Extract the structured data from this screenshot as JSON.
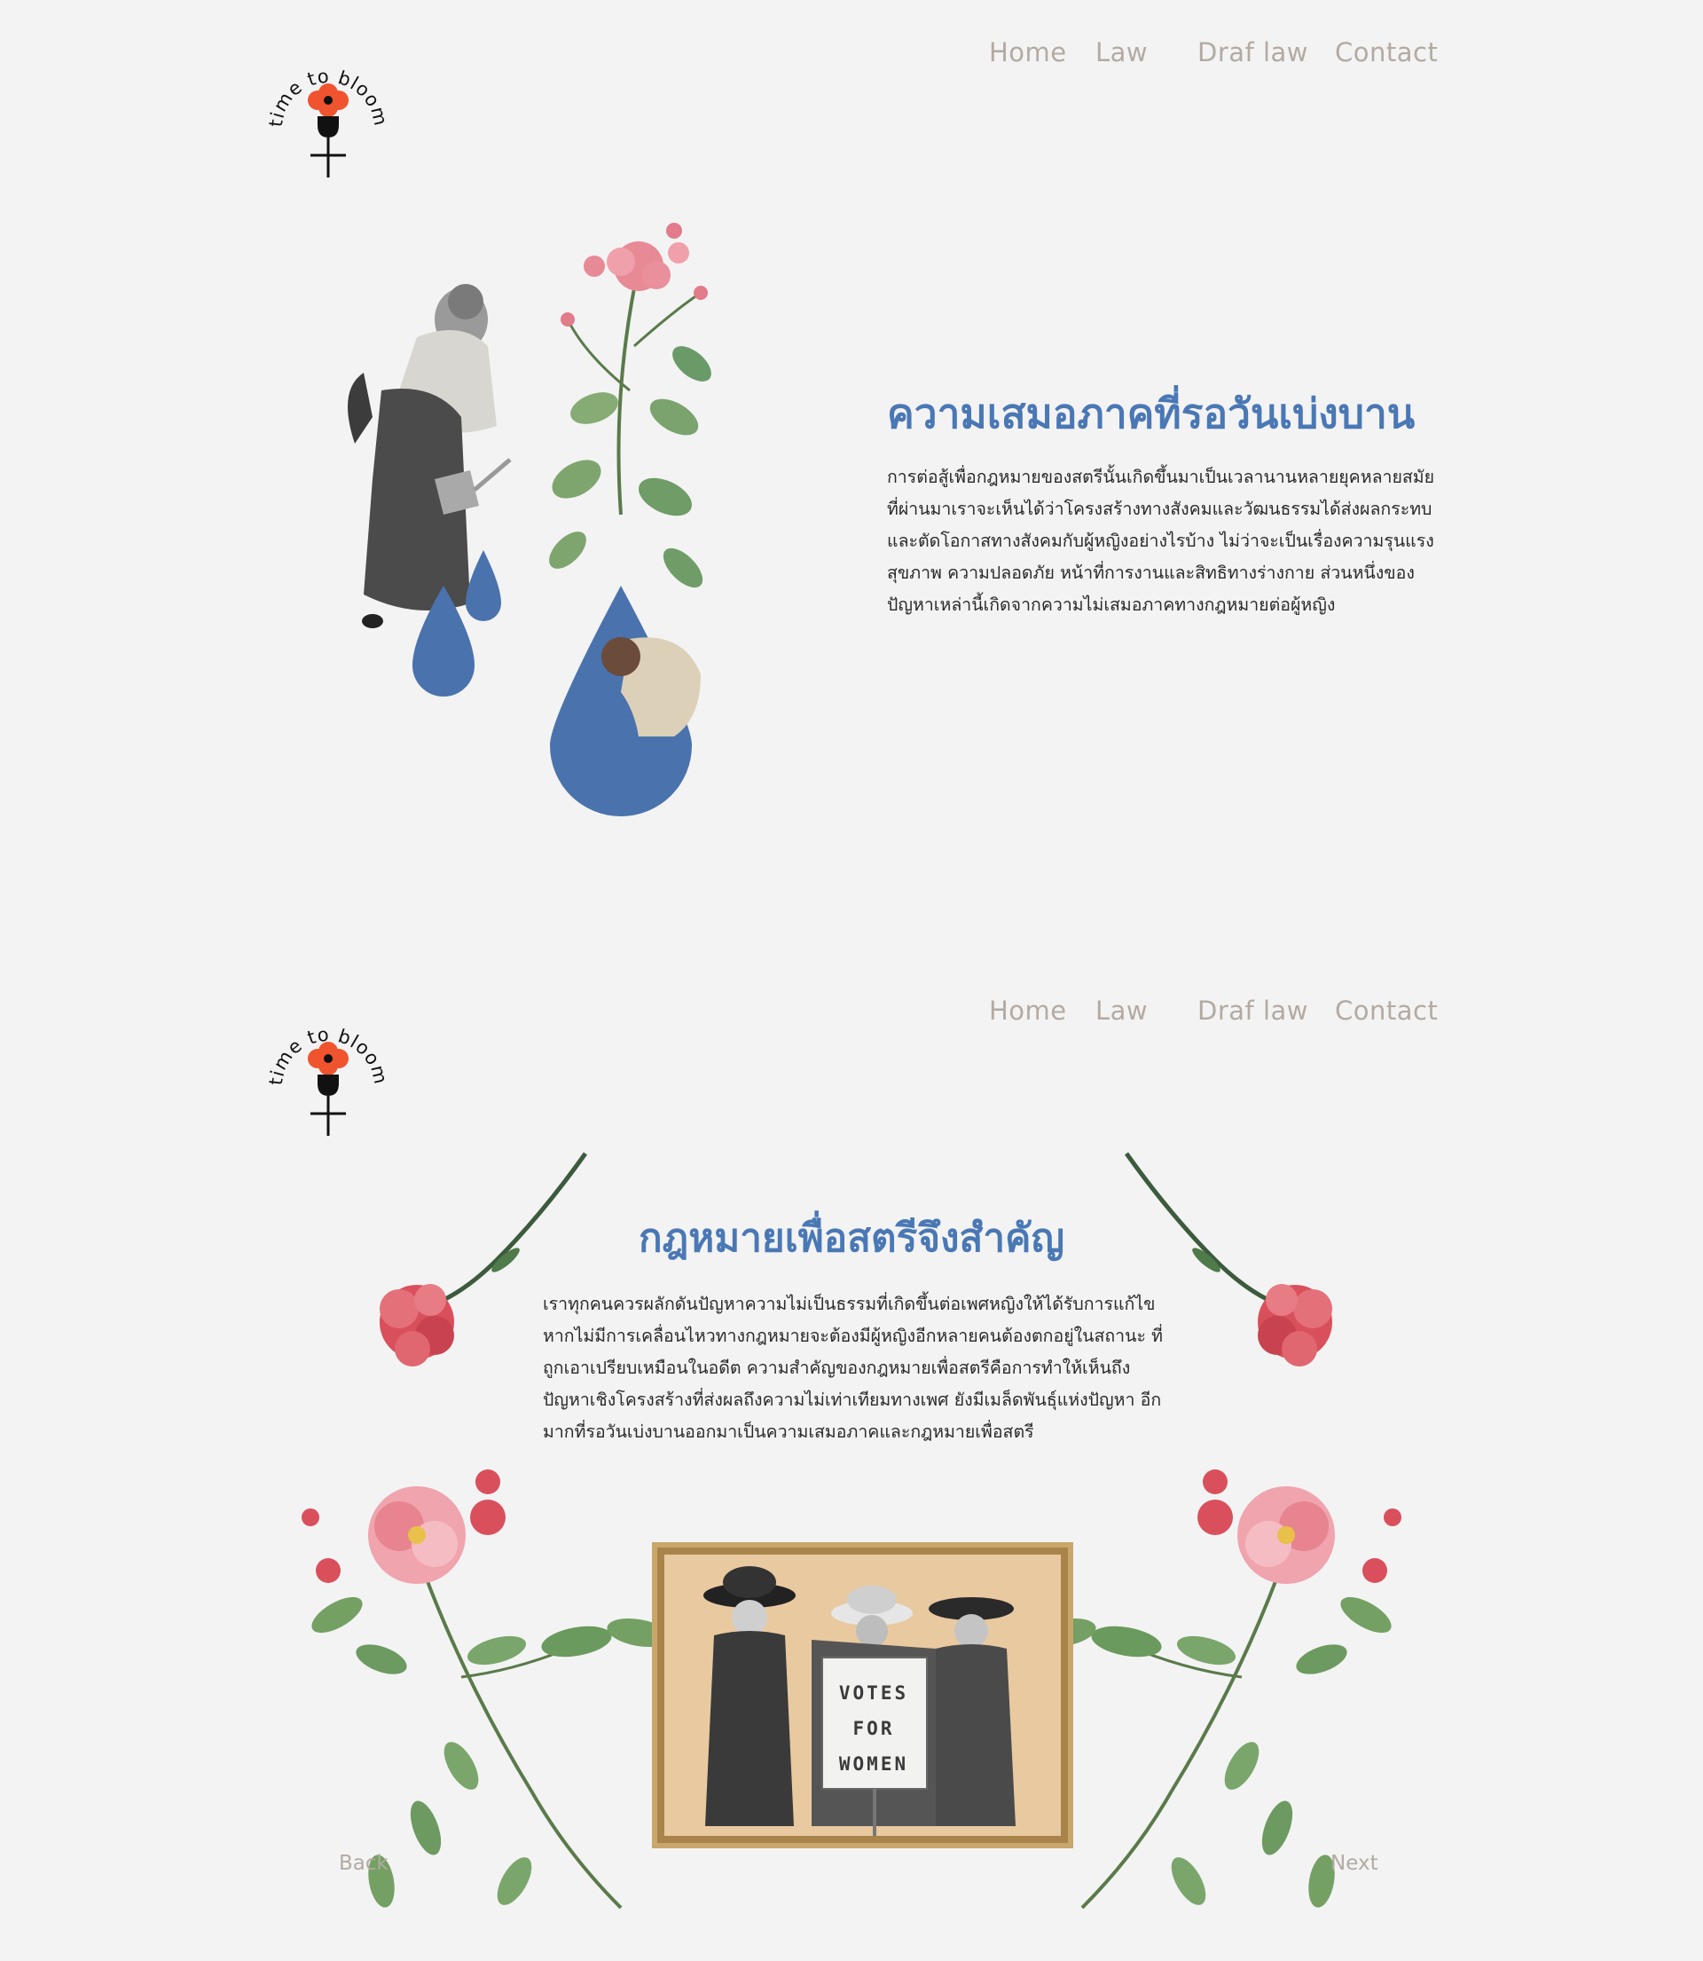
{
  "brand": {
    "logo_text": "time to bloom",
    "accent_color": "#f0542e",
    "ink_color": "#111111"
  },
  "nav": {
    "items": [
      "Home",
      "Law",
      "Draf law",
      "Contact"
    ],
    "color": "#b3aaa2"
  },
  "section1": {
    "title": "ความเสมอภาคที่รอวันเบ่งบาน",
    "body": "การต่อสู้เพื่อกฎหมายของสตรีนั้นเกิดขึ้นมาเป็นเวลานานหลายยุคหลายสมัย ที่ผ่านมาเราจะเห็นได้ว่าโครงสร้างทางสังคมและวัฒนธรรมได้ส่งผลกระทบ และตัดโอกาสทางสังคมกับผู้หญิงอย่างไรบ้าง ไม่ว่าจะเป็นเรื่องความรุนแรง สุขภาพ ความปลอดภัย หน้าที่การงานและสิทธิทางร่างกาย ส่วนหนึ่งของ ปัญหาเหล่านี้เกิดจากความไม่เสมอภาคทางกฎหมายต่อผู้หญิง",
    "title_color": "#4a78b5",
    "drop_color": "#4a72ad"
  },
  "section2": {
    "title": "กฎหมายเพื่อสตรีจึงสำคัญ",
    "body": "เราทุกคนควรผลักดันปัญหาความไม่เป็นธรรมที่เกิดขึ้นต่อเพศหญิงให้ได้รับการแก้ไข หากไม่มีการเคลื่อนไหวทางกฎหมายจะต้องมีผู้หญิงอีกหลายคนต้องตกอยู่ในสถานะ ที่ถูกเอาเปรียบเหมือนในอดีต ความสำคัญของกฎหมายเพื่อสตรีคือการทำให้เห็นถึง ปัญหาเชิงโครงสร้างที่ส่งผลถึงความไม่เท่าเทียมทางเพศ ยังมีเมล็ดพันธุ์แห่งปัญหา อีกมากที่รอวันเบ่งบานออกมาเป็นความเสมอภาคและกฎหมายเพื่อสตรี",
    "sign_lines": [
      "VOTES",
      "FOR",
      "WOMEN"
    ],
    "back_label": "Back",
    "next_label": "Next"
  }
}
